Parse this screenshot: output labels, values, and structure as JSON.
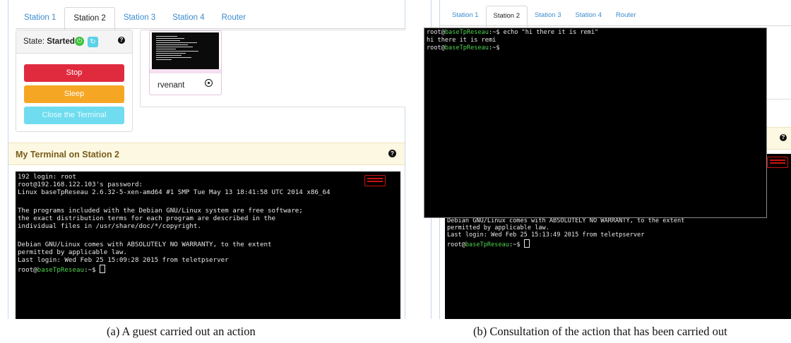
{
  "panel_a": {
    "tabs": [
      "Station 1",
      "Station 2",
      "Station 3",
      "Station 4",
      "Router"
    ],
    "state": {
      "label": "State:",
      "value": "Started"
    },
    "buttons": {
      "stop": "Stop",
      "sleep": "Sleep",
      "close": "Close the Terminal"
    },
    "user": {
      "name": "rvenant"
    },
    "terminal_title": "My Terminal on Station 2",
    "terminal_lines": [
      "192 login: root",
      "root@192.168.122.103's password:",
      "Linux baseTpReseau 2.6.32-5-xen-amd64 #1 SMP Tue May 13 18:41:58 UTC 2014 x86_64",
      "",
      "The programs included with the Debian GNU/Linux system are free software;",
      "the exact distribution terms for each program are described in the",
      "individual files in /usr/share/doc/*/copyright.",
      "",
      "Debian GNU/Linux comes with ABSOLUTELY NO WARRANTY, to the extent",
      "permitted by applicable law.",
      "Last login: Wed Feb 25 15:09:28 2015 from teletpserver"
    ],
    "prompt": {
      "user": "root@",
      "host": "baseTpReseau",
      "tail": ":~$ "
    }
  },
  "panel_b": {
    "tabs": [
      "Station 1",
      "Station 2",
      "Station 3",
      "Station 4",
      "Router"
    ],
    "overlay_cmd": "echo \"hi there it is remi\"",
    "overlay_output": "hi there it is remi",
    "bg_lines": [
      "Debian GNU/Linux comes with ABSOLUTELY NO WARRANTY, to the extent",
      "permitted by applicable law.",
      "Last login: Wed Feb 25 15:13:49 2015 from teletpserver"
    ],
    "prompt": {
      "user": "root@",
      "host": "baseTpReseau",
      "tail": ":~$ "
    }
  },
  "captions": {
    "a": "(a) A guest carried out an action",
    "b": "(b) Consultation of the action that has been carried out"
  },
  "colors": {
    "tab_link": "#3a8bd0",
    "stop": "#e02b3f",
    "sleep": "#f5a623",
    "close": "#6fdcef",
    "started": "#3cc13c",
    "host_green": "#4fd34f",
    "terminal_header": "#fcf8e1"
  },
  "icons": [
    "power-icon",
    "refresh-icon",
    "help-icon",
    "eye-icon",
    "keyboard-icon"
  ]
}
